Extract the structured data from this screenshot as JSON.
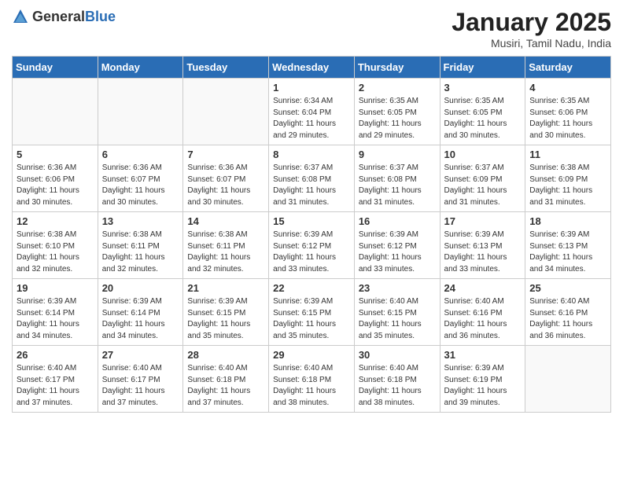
{
  "header": {
    "logo_general": "General",
    "logo_blue": "Blue",
    "month_title": "January 2025",
    "location": "Musiri, Tamil Nadu, India"
  },
  "weekdays": [
    "Sunday",
    "Monday",
    "Tuesday",
    "Wednesday",
    "Thursday",
    "Friday",
    "Saturday"
  ],
  "weeks": [
    [
      {
        "day": "",
        "info": ""
      },
      {
        "day": "",
        "info": ""
      },
      {
        "day": "",
        "info": ""
      },
      {
        "day": "1",
        "info": "Sunrise: 6:34 AM\nSunset: 6:04 PM\nDaylight: 11 hours and 29 minutes."
      },
      {
        "day": "2",
        "info": "Sunrise: 6:35 AM\nSunset: 6:05 PM\nDaylight: 11 hours and 29 minutes."
      },
      {
        "day": "3",
        "info": "Sunrise: 6:35 AM\nSunset: 6:05 PM\nDaylight: 11 hours and 30 minutes."
      },
      {
        "day": "4",
        "info": "Sunrise: 6:35 AM\nSunset: 6:06 PM\nDaylight: 11 hours and 30 minutes."
      }
    ],
    [
      {
        "day": "5",
        "info": "Sunrise: 6:36 AM\nSunset: 6:06 PM\nDaylight: 11 hours and 30 minutes."
      },
      {
        "day": "6",
        "info": "Sunrise: 6:36 AM\nSunset: 6:07 PM\nDaylight: 11 hours and 30 minutes."
      },
      {
        "day": "7",
        "info": "Sunrise: 6:36 AM\nSunset: 6:07 PM\nDaylight: 11 hours and 30 minutes."
      },
      {
        "day": "8",
        "info": "Sunrise: 6:37 AM\nSunset: 6:08 PM\nDaylight: 11 hours and 31 minutes."
      },
      {
        "day": "9",
        "info": "Sunrise: 6:37 AM\nSunset: 6:08 PM\nDaylight: 11 hours and 31 minutes."
      },
      {
        "day": "10",
        "info": "Sunrise: 6:37 AM\nSunset: 6:09 PM\nDaylight: 11 hours and 31 minutes."
      },
      {
        "day": "11",
        "info": "Sunrise: 6:38 AM\nSunset: 6:09 PM\nDaylight: 11 hours and 31 minutes."
      }
    ],
    [
      {
        "day": "12",
        "info": "Sunrise: 6:38 AM\nSunset: 6:10 PM\nDaylight: 11 hours and 32 minutes."
      },
      {
        "day": "13",
        "info": "Sunrise: 6:38 AM\nSunset: 6:11 PM\nDaylight: 11 hours and 32 minutes."
      },
      {
        "day": "14",
        "info": "Sunrise: 6:38 AM\nSunset: 6:11 PM\nDaylight: 11 hours and 32 minutes."
      },
      {
        "day": "15",
        "info": "Sunrise: 6:39 AM\nSunset: 6:12 PM\nDaylight: 11 hours and 33 minutes."
      },
      {
        "day": "16",
        "info": "Sunrise: 6:39 AM\nSunset: 6:12 PM\nDaylight: 11 hours and 33 minutes."
      },
      {
        "day": "17",
        "info": "Sunrise: 6:39 AM\nSunset: 6:13 PM\nDaylight: 11 hours and 33 minutes."
      },
      {
        "day": "18",
        "info": "Sunrise: 6:39 AM\nSunset: 6:13 PM\nDaylight: 11 hours and 34 minutes."
      }
    ],
    [
      {
        "day": "19",
        "info": "Sunrise: 6:39 AM\nSunset: 6:14 PM\nDaylight: 11 hours and 34 minutes."
      },
      {
        "day": "20",
        "info": "Sunrise: 6:39 AM\nSunset: 6:14 PM\nDaylight: 11 hours and 34 minutes."
      },
      {
        "day": "21",
        "info": "Sunrise: 6:39 AM\nSunset: 6:15 PM\nDaylight: 11 hours and 35 minutes."
      },
      {
        "day": "22",
        "info": "Sunrise: 6:39 AM\nSunset: 6:15 PM\nDaylight: 11 hours and 35 minutes."
      },
      {
        "day": "23",
        "info": "Sunrise: 6:40 AM\nSunset: 6:15 PM\nDaylight: 11 hours and 35 minutes."
      },
      {
        "day": "24",
        "info": "Sunrise: 6:40 AM\nSunset: 6:16 PM\nDaylight: 11 hours and 36 minutes."
      },
      {
        "day": "25",
        "info": "Sunrise: 6:40 AM\nSunset: 6:16 PM\nDaylight: 11 hours and 36 minutes."
      }
    ],
    [
      {
        "day": "26",
        "info": "Sunrise: 6:40 AM\nSunset: 6:17 PM\nDaylight: 11 hours and 37 minutes."
      },
      {
        "day": "27",
        "info": "Sunrise: 6:40 AM\nSunset: 6:17 PM\nDaylight: 11 hours and 37 minutes."
      },
      {
        "day": "28",
        "info": "Sunrise: 6:40 AM\nSunset: 6:18 PM\nDaylight: 11 hours and 37 minutes."
      },
      {
        "day": "29",
        "info": "Sunrise: 6:40 AM\nSunset: 6:18 PM\nDaylight: 11 hours and 38 minutes."
      },
      {
        "day": "30",
        "info": "Sunrise: 6:40 AM\nSunset: 6:18 PM\nDaylight: 11 hours and 38 minutes."
      },
      {
        "day": "31",
        "info": "Sunrise: 6:39 AM\nSunset: 6:19 PM\nDaylight: 11 hours and 39 minutes."
      },
      {
        "day": "",
        "info": ""
      }
    ]
  ]
}
